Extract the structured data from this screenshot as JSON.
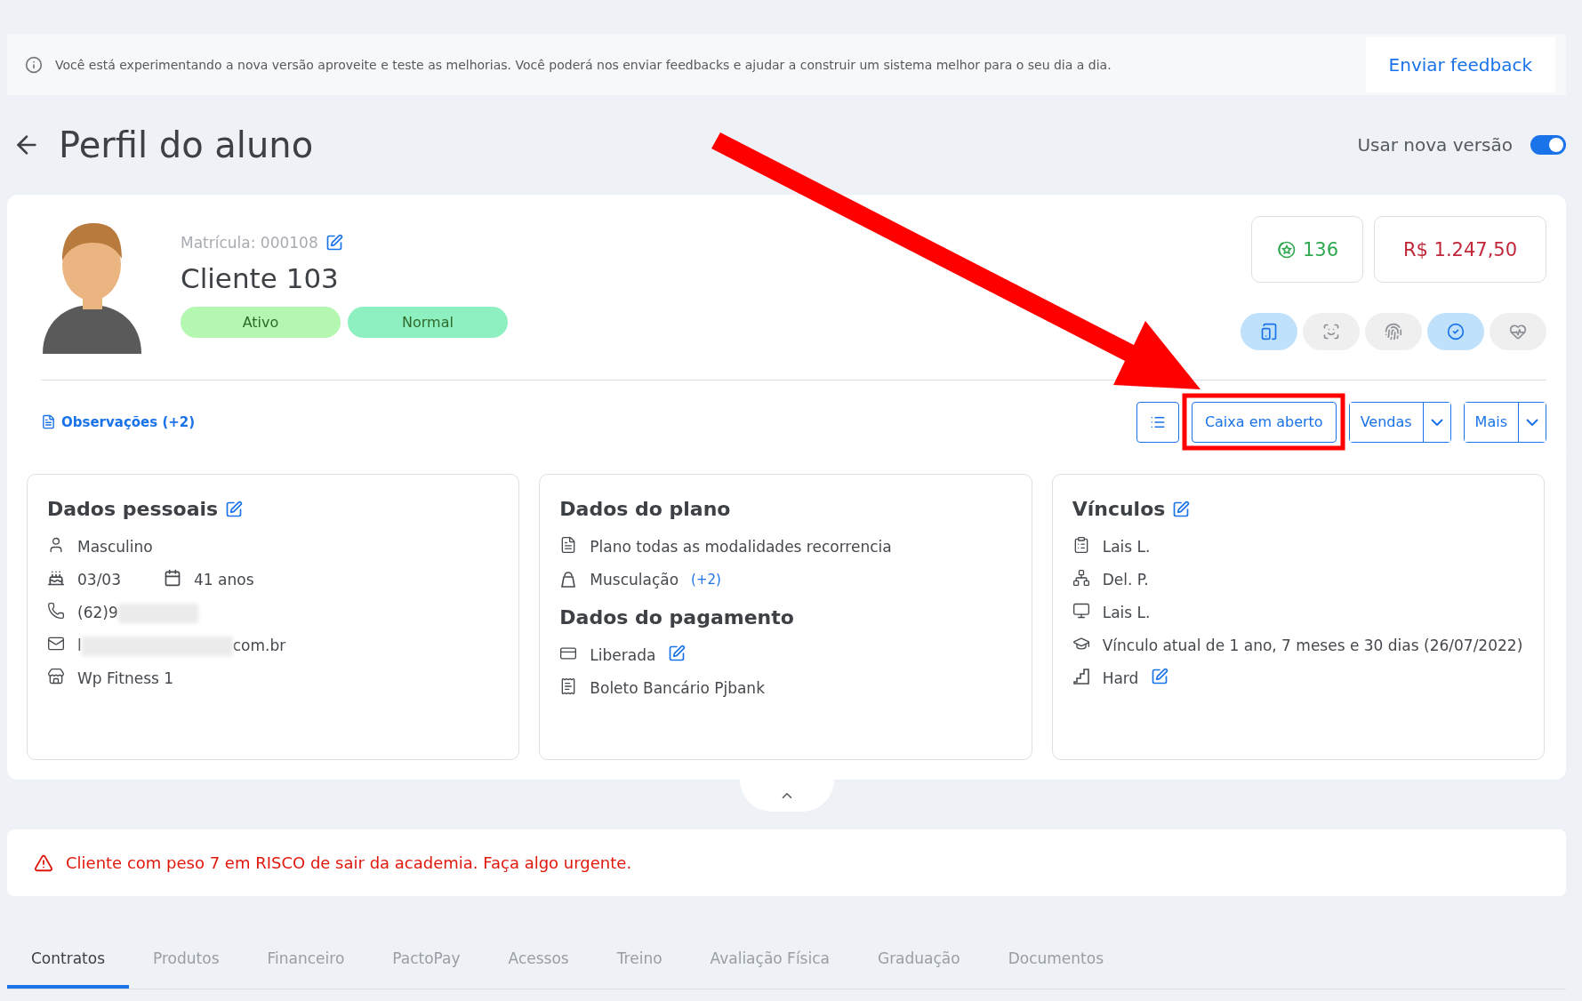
{
  "banner": {
    "message": "Você está experimentando a nova versão aproveite e teste as melhorias. Você poderá nos enviar feedbacks e ajudar a construir um sistema melhor para o seu dia a dia.",
    "action": "Enviar feedback"
  },
  "header": {
    "title": "Perfil do aluno",
    "toggle": {
      "label": "Usar nova versão",
      "on": true
    }
  },
  "profile": {
    "registration": "Matrícula: 000108",
    "name": "Cliente 103",
    "badges": [
      {
        "label": "Ativo",
        "color": "#b3f7b0"
      },
      {
        "label": "Normal",
        "color": "#8eefc0"
      }
    ],
    "points": "136",
    "balance": "R$ 1.247,50",
    "quick_actions": [
      {
        "kind": "tablet",
        "active": true
      },
      {
        "kind": "face",
        "active": false
      },
      {
        "kind": "fingerprint",
        "active": false
      },
      {
        "kind": "check",
        "active": true
      },
      {
        "kind": "heart",
        "active": false
      }
    ],
    "notes_link": "Observações (+2)",
    "buttons": [
      {
        "kind": "icon"
      },
      {
        "kind": "plain",
        "label": "Caixa em aberto"
      },
      {
        "kind": "split",
        "label": "Vendas"
      },
      {
        "kind": "split",
        "label": "Mais"
      }
    ]
  },
  "cards": [
    {
      "sections": [
        {
          "title": "Dados pessoais",
          "editable": true,
          "rows": [
            {
              "kind": "gender",
              "text": "Masculino"
            },
            {
              "kind": "birthday",
              "text": "03/03",
              "age": "41 anos"
            },
            {
              "kind": "phone",
              "text": "(62)9",
              "redacted": true
            },
            {
              "kind": "email",
              "text": "l",
              "suffix": "com.br",
              "redacted": true
            },
            {
              "kind": "unit",
              "text": "Wp Fitness 1"
            }
          ]
        }
      ]
    },
    {
      "sections": [
        {
          "title": "Dados do plano",
          "rows": [
            {
              "kind": "plan",
              "text": "Plano todas as modalidades recorrencia"
            },
            {
              "kind": "modality",
              "text": "Musculação",
              "extra": "(+2)"
            }
          ]
        },
        {
          "title": "Dados do pagamento",
          "rows": [
            {
              "kind": "card",
              "text": "Liberada",
              "editable": true
            },
            {
              "kind": "billing",
              "text": "Boleto Bancário Pjbank"
            }
          ]
        }
      ]
    },
    {
      "sections": [
        {
          "title": "Vínculos",
          "editable": true,
          "rows": [
            {
              "kind": "consultant",
              "text": "Lais L."
            },
            {
              "kind": "group",
              "text": "Del. P."
            },
            {
              "kind": "screen",
              "text": "Lais L."
            },
            {
              "kind": "course",
              "text": "Vínculo atual de 1 ano, 7 meses e 30 dias (26/07/2022)"
            },
            {
              "kind": "level",
              "text": "Hard",
              "editable": true
            }
          ]
        }
      ]
    }
  ],
  "alert": "Cliente com peso 7 em RISCO de sair da academia. Faça algo urgente.",
  "tabs": [
    {
      "label": "Contratos",
      "selected": true
    },
    {
      "label": "Produtos",
      "selected": false
    },
    {
      "label": "Financeiro",
      "selected": false
    },
    {
      "label": "PactoPay",
      "selected": false
    },
    {
      "label": "Acessos",
      "selected": false
    },
    {
      "label": "Treino",
      "selected": false
    },
    {
      "label": "Avaliação Física",
      "selected": false
    },
    {
      "label": "Graduação",
      "selected": false
    },
    {
      "label": "Documentos",
      "selected": false
    }
  ]
}
